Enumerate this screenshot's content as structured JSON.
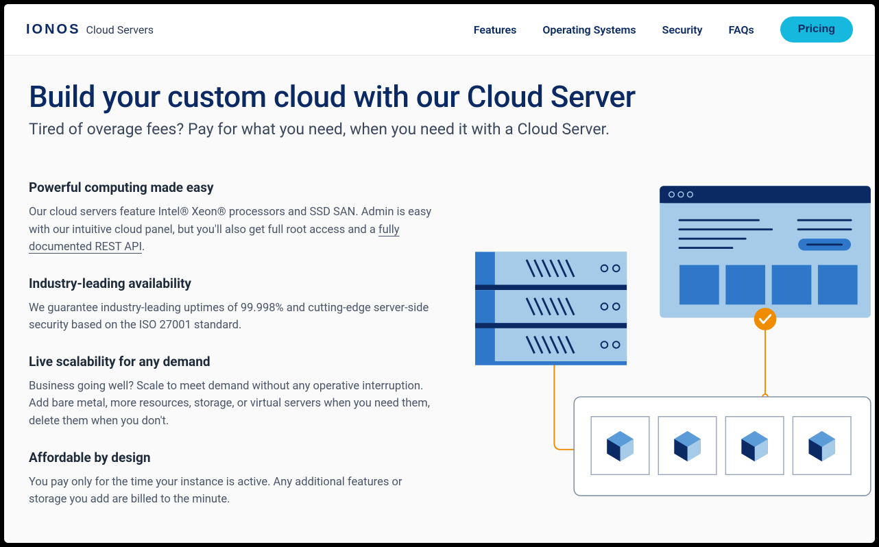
{
  "brand": {
    "logo": "IONOS",
    "sub": "Cloud Servers"
  },
  "nav": {
    "features": "Features",
    "os": "Operating Systems",
    "security": "Security",
    "faqs": "FAQs",
    "pricing": "Pricing"
  },
  "hero": {
    "title": "Build your custom cloud with our Cloud Server",
    "subtitle": "Tired of overage fees? Pay for what you need, when you need it with a Cloud Server."
  },
  "features": {
    "f1": {
      "title": "Powerful computing made easy",
      "body_pre": "Our cloud servers feature Intel® Xeon® processors and SSD SAN. Admin is easy with our intuitive cloud panel, but you'll also get full root access and a ",
      "link": "fully documented REST API",
      "body_post": "."
    },
    "f2": {
      "title": "Industry-leading availability",
      "body": "We guarantee industry-leading uptimes of 99.998% and cutting-edge server-side security based on the ISO 27001 standard."
    },
    "f3": {
      "title": "Live scalability for any demand",
      "body": "Business going well? Scale to meet demand without any operative interruption. Add bare metal, more resources, storage, or virtual servers when you need them, delete them when you don't."
    },
    "f4": {
      "title": "Affordable by design",
      "body": "You pay only for the time your instance is active. Any additional features or storage you add are billed to the minute."
    }
  }
}
